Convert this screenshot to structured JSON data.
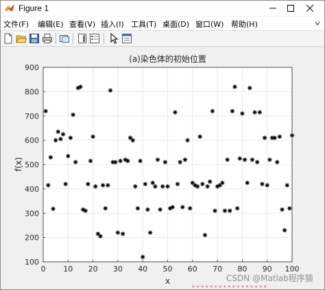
{
  "window": {
    "title": "Figure 1",
    "controls": [
      "minimize",
      "maximize",
      "close"
    ]
  },
  "menu": {
    "items": [
      {
        "label": "文件(F)"
      },
      {
        "label": "编辑(E)"
      },
      {
        "label": "查看(V)"
      },
      {
        "label": "插入(I)"
      },
      {
        "label": "工具(T)"
      },
      {
        "label": "桌面(D)"
      },
      {
        "label": "窗口(W)"
      },
      {
        "label": "帮助(H)"
      }
    ],
    "expand_icon": "chevron-icon"
  },
  "toolbar": {
    "buttons": [
      "new-figure-icon",
      "open-file-icon",
      "save-icon",
      "print-icon",
      "link-plot-icon",
      "insert-colorbar-icon",
      "insert-legend-icon",
      "edit-plot-arrow-icon",
      "property-inspector-icon"
    ]
  },
  "watermark": "CSDN @Matlab程序猿",
  "chart_data": {
    "type": "scatter",
    "title": "(a)染色体的初始位置",
    "xlabel": "x",
    "ylabel": "f(x)",
    "xlim": [
      0,
      100
    ],
    "ylim": [
      100,
      900
    ],
    "xticks": [
      0,
      10,
      20,
      30,
      40,
      50,
      60,
      70,
      80,
      90,
      100
    ],
    "yticks": [
      100,
      200,
      300,
      400,
      500,
      600,
      700,
      800,
      900
    ],
    "grid": true,
    "marker": "*",
    "color": "#000000",
    "x": [
      1,
      2,
      3,
      4,
      5,
      6,
      7,
      8,
      9,
      10,
      11,
      12,
      13,
      14,
      15,
      16,
      17,
      18,
      19,
      20,
      21,
      22,
      23,
      24,
      25,
      26,
      27,
      28,
      29,
      30,
      31,
      32,
      33,
      34,
      35,
      36,
      37,
      38,
      39,
      40,
      41,
      42,
      43,
      44,
      45,
      46,
      47,
      48,
      49,
      50,
      51,
      52,
      53,
      54,
      55,
      56,
      57,
      58,
      59,
      60,
      61,
      62,
      63,
      64,
      65,
      66,
      67,
      68,
      69,
      70,
      71,
      72,
      73,
      74,
      75,
      76,
      77,
      78,
      79,
      80,
      81,
      82,
      83,
      84,
      85,
      86,
      87,
      88,
      89,
      90,
      91,
      92,
      93,
      94,
      95,
      96,
      97,
      98,
      99,
      100
    ],
    "y": [
      720,
      415,
      530,
      318,
      600,
      635,
      605,
      625,
      420,
      535,
      610,
      705,
      510,
      815,
      820,
      315,
      310,
      420,
      515,
      615,
      410,
      215,
      205,
      415,
      320,
      415,
      805,
      510,
      510,
      220,
      515,
      215,
      520,
      515,
      610,
      600,
      410,
      320,
      515,
      120,
      420,
      315,
      220,
      425,
      410,
      520,
      315,
      410,
      510,
      410,
      320,
      325,
      715,
      420,
      510,
      325,
      520,
      600,
      320,
      425,
      415,
      410,
      615,
      420,
      210,
      410,
      430,
      720,
      310,
      410,
      415,
      425,
      310,
      520,
      310,
      720,
      820,
      320,
      525,
      710,
      520,
      425,
      815,
      520,
      715,
      510,
      715,
      420,
      610,
      415,
      520,
      610,
      610,
      510,
      615,
      315,
      230,
      415,
      320,
      620
    ]
  }
}
